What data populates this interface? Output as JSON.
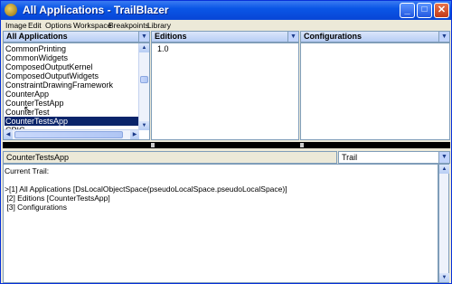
{
  "window": {
    "title": "All Applications - TrailBlazer"
  },
  "titlebar_buttons": {
    "minimize": "_",
    "maximize": "□",
    "close": "✕"
  },
  "menu": [
    "Image",
    "Edit",
    "Options",
    "Workspace",
    "Breakpoints",
    "Library"
  ],
  "panes": {
    "applications": {
      "header": "All Applications",
      "items": [
        "CommonPrinting",
        "CommonWidgets",
        "ComposedOutputKernel",
        "ComposedOutputWidgets",
        "ConstraintDrawingFramework",
        "CounterApp",
        "CounterTestApp",
        "CounterTest",
        "CounterTestsApp",
        "CPIC"
      ],
      "selected": "CounterTestsApp"
    },
    "editions": {
      "header": "Editions",
      "items": [
        "1.0"
      ]
    },
    "configurations": {
      "header": "Configurations",
      "items": []
    }
  },
  "bottom": {
    "selected_app": "CounterTestsApp",
    "trail_dropdown": "Trail",
    "lines": [
      "Current Trail:",
      "",
      ">[1] All Applications [DsLocalObjectSpace(pseudoLocalSpace.pseudoLocalSpace)]",
      " [2] Editions [CounterTestsApp]",
      " [3] Configurations"
    ]
  },
  "icons": {
    "dropdown_arrow": "▼",
    "scroll_up": "▲",
    "scroll_down": "▼",
    "scroll_left": "◀",
    "scroll_right": "▶"
  }
}
